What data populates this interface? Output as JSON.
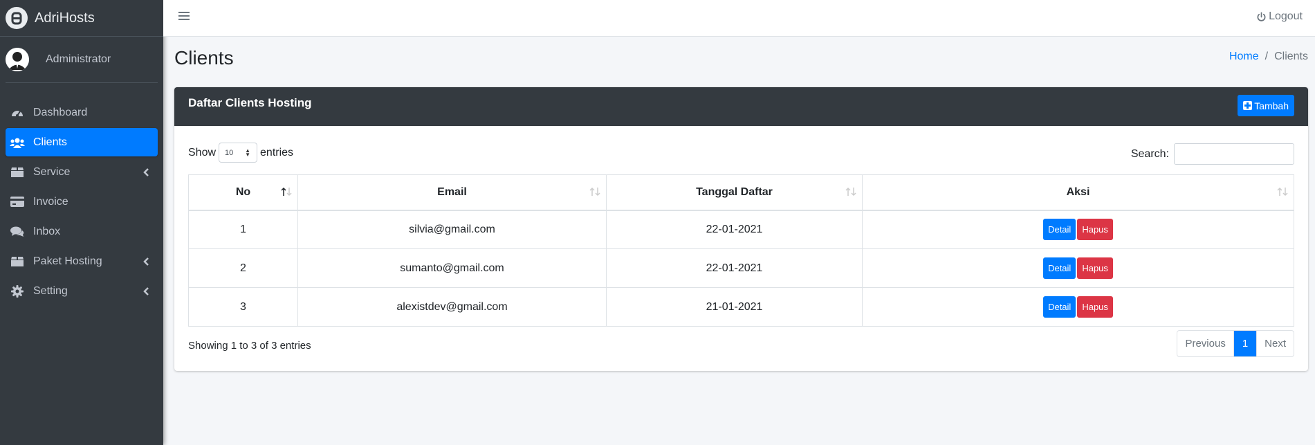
{
  "brand": {
    "name": "AdriHosts"
  },
  "user": {
    "name": "Administrator"
  },
  "sidebar": {
    "items": [
      {
        "label": "Dashboard",
        "icon": "tachometer-icon",
        "active": false,
        "chevron": false
      },
      {
        "label": "Clients",
        "icon": "users-icon",
        "active": true,
        "chevron": false
      },
      {
        "label": "Service",
        "icon": "box-icon",
        "active": false,
        "chevron": true
      },
      {
        "label": "Invoice",
        "icon": "credit-card-icon",
        "active": false,
        "chevron": false
      },
      {
        "label": "Inbox",
        "icon": "comments-icon",
        "active": false,
        "chevron": false
      },
      {
        "label": "Paket Hosting",
        "icon": "box-icon",
        "active": false,
        "chevron": true
      },
      {
        "label": "Setting",
        "icon": "gear-icon",
        "active": false,
        "chevron": true
      }
    ]
  },
  "topbar": {
    "logout_label": "Logout"
  },
  "page": {
    "title": "Clients",
    "breadcrumb": {
      "home": "Home",
      "separator": "/",
      "current": "Clients"
    }
  },
  "card": {
    "title": "Daftar Clients Hosting",
    "add_button": "Tambah",
    "show_label": "Show",
    "entries_label": "entries",
    "length_value": "10",
    "search_label": "Search:",
    "search_value": "",
    "columns": [
      "No",
      "Email",
      "Tanggal Daftar",
      "Aksi"
    ],
    "rows": [
      {
        "no": "1",
        "email": "silvia@gmail.com",
        "date": "22-01-2021"
      },
      {
        "no": "2",
        "email": "sumanto@gmail.com",
        "date": "22-01-2021"
      },
      {
        "no": "3",
        "email": "alexistdev@gmail.com",
        "date": "21-01-2021"
      }
    ],
    "detail_label": "Detail",
    "delete_label": "Hapus",
    "info": "Showing 1 to 3 of 3 entries",
    "pagination": {
      "previous": "Previous",
      "current": "1",
      "next": "Next"
    }
  },
  "colors": {
    "sidebar": "#343a40",
    "primary": "#007bff",
    "danger": "#dc3545",
    "header": "#343a40",
    "background": "#f4f6f9"
  }
}
